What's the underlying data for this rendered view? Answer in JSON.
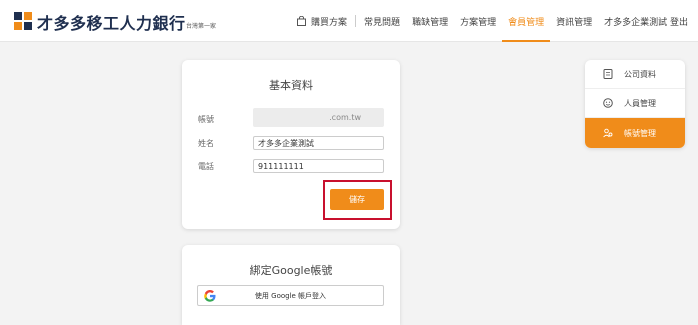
{
  "brand": {
    "name": "才多多移工人力銀行",
    "tagline": "台灣第一家",
    "colors": {
      "accent": "#f08c1a",
      "navy": "#1f2f4f",
      "highlight": "#c8102e"
    }
  },
  "nav": {
    "items": [
      {
        "label": "購買方案",
        "icon": "shopping-bag-icon"
      },
      {
        "label": "常見問題"
      },
      {
        "label": "職缺管理"
      },
      {
        "label": "方案管理"
      },
      {
        "label": "會員管理",
        "active": true
      },
      {
        "label": "資訊管理"
      },
      {
        "label": "才多多企業測試 登出"
      }
    ]
  },
  "profile": {
    "title": "基本資料",
    "account_label": "帳號",
    "account_value": ".com.tw",
    "name_label": "姓名",
    "name_value": "才多多企業測試",
    "phone_label": "電話",
    "phone_value": "911111111",
    "save_label": "儲存"
  },
  "google": {
    "title": "綁定Google帳號",
    "button_label": "使用 Google 帳戶登入"
  },
  "side_menu": {
    "items": [
      {
        "label": "公司資料",
        "icon": "document-icon"
      },
      {
        "label": "人員管理",
        "icon": "user-face-icon"
      },
      {
        "label": "帳號管理",
        "icon": "account-users-icon",
        "active": true
      }
    ]
  }
}
